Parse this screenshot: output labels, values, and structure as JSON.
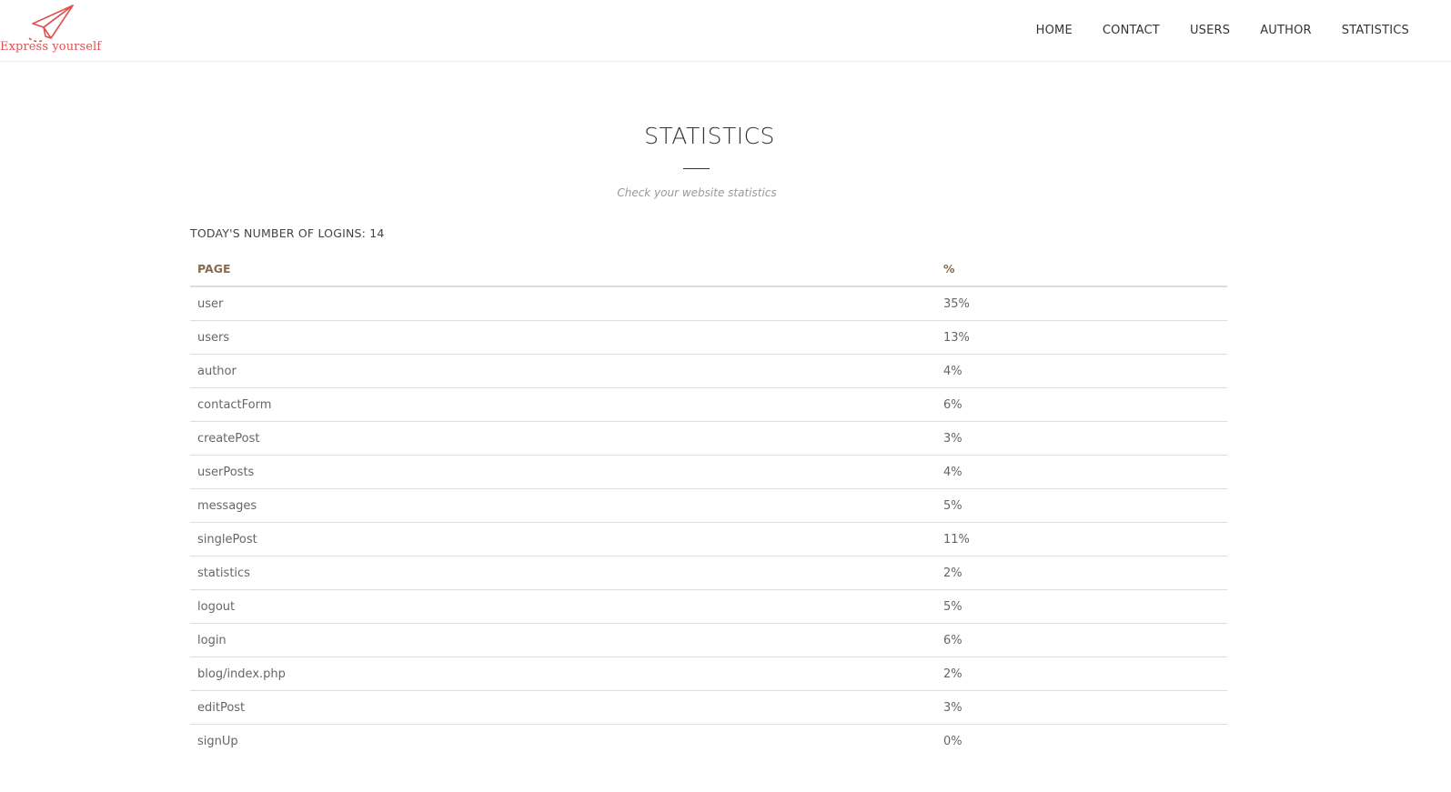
{
  "brand": {
    "name": "Express yourself",
    "accent": "#e05050"
  },
  "nav": {
    "items": [
      "HOME",
      "CONTACT",
      "USERS",
      "AUTHOR",
      "STATISTICS"
    ]
  },
  "page": {
    "title": "STATISTICS",
    "subtitle": "Check your website statistics",
    "logins_label": "TODAY'S NUMBER OF LOGINS: 14"
  },
  "table": {
    "headers": [
      "PAGE",
      "%"
    ],
    "rows": [
      [
        "user",
        "35%"
      ],
      [
        "users",
        "13%"
      ],
      [
        "author",
        "4%"
      ],
      [
        "contactForm",
        "6%"
      ],
      [
        "createPost",
        "3%"
      ],
      [
        "userPosts",
        "4%"
      ],
      [
        "messages",
        "5%"
      ],
      [
        "singlePost",
        "11%"
      ],
      [
        "statistics",
        "2%"
      ],
      [
        "logout",
        "5%"
      ],
      [
        "login",
        "6%"
      ],
      [
        "blog/index.php",
        "2%"
      ],
      [
        "editPost",
        "3%"
      ],
      [
        "signUp",
        "0%"
      ]
    ]
  }
}
